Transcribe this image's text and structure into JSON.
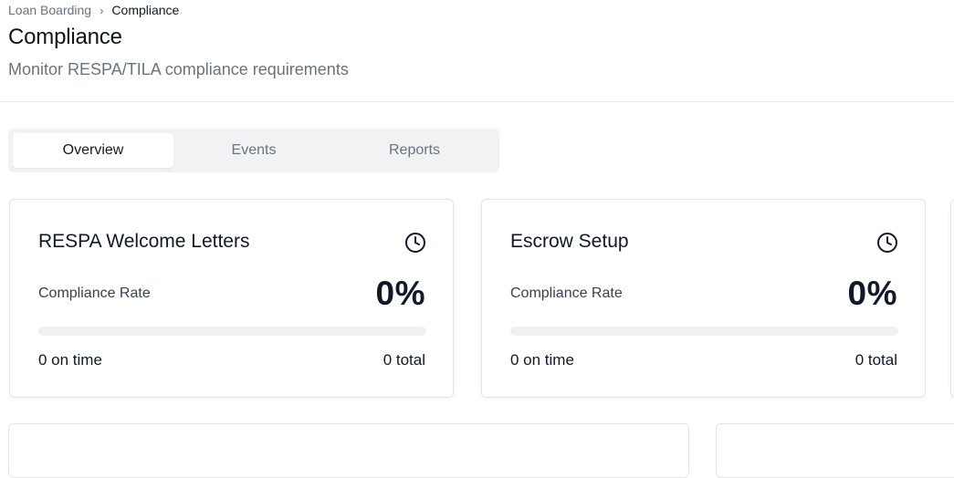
{
  "breadcrumb": {
    "parent": "Loan Boarding",
    "separator": "›",
    "current": "Compliance"
  },
  "page": {
    "title": "Compliance",
    "subtitle": "Monitor RESPA/TILA compliance requirements"
  },
  "tabs": [
    {
      "label": "Overview",
      "active": true
    },
    {
      "label": "Events",
      "active": false
    },
    {
      "label": "Reports",
      "active": false
    }
  ],
  "cards": [
    {
      "title": "RESPA Welcome Letters",
      "icon": "clock-icon",
      "rate_label": "Compliance Rate",
      "rate_value": "0%",
      "rate_fraction": 0,
      "on_time": "0 on time",
      "total": "0 total"
    },
    {
      "title": "Escrow Setup",
      "icon": "clock-icon",
      "rate_label": "Compliance Rate",
      "rate_value": "0%",
      "rate_fraction": 0,
      "on_time": "0 on time",
      "total": "0 total"
    }
  ],
  "colors": {
    "progress_track": "#eef0f2",
    "progress_fill": "#111827",
    "tab_bar": "#f1f2f4"
  }
}
